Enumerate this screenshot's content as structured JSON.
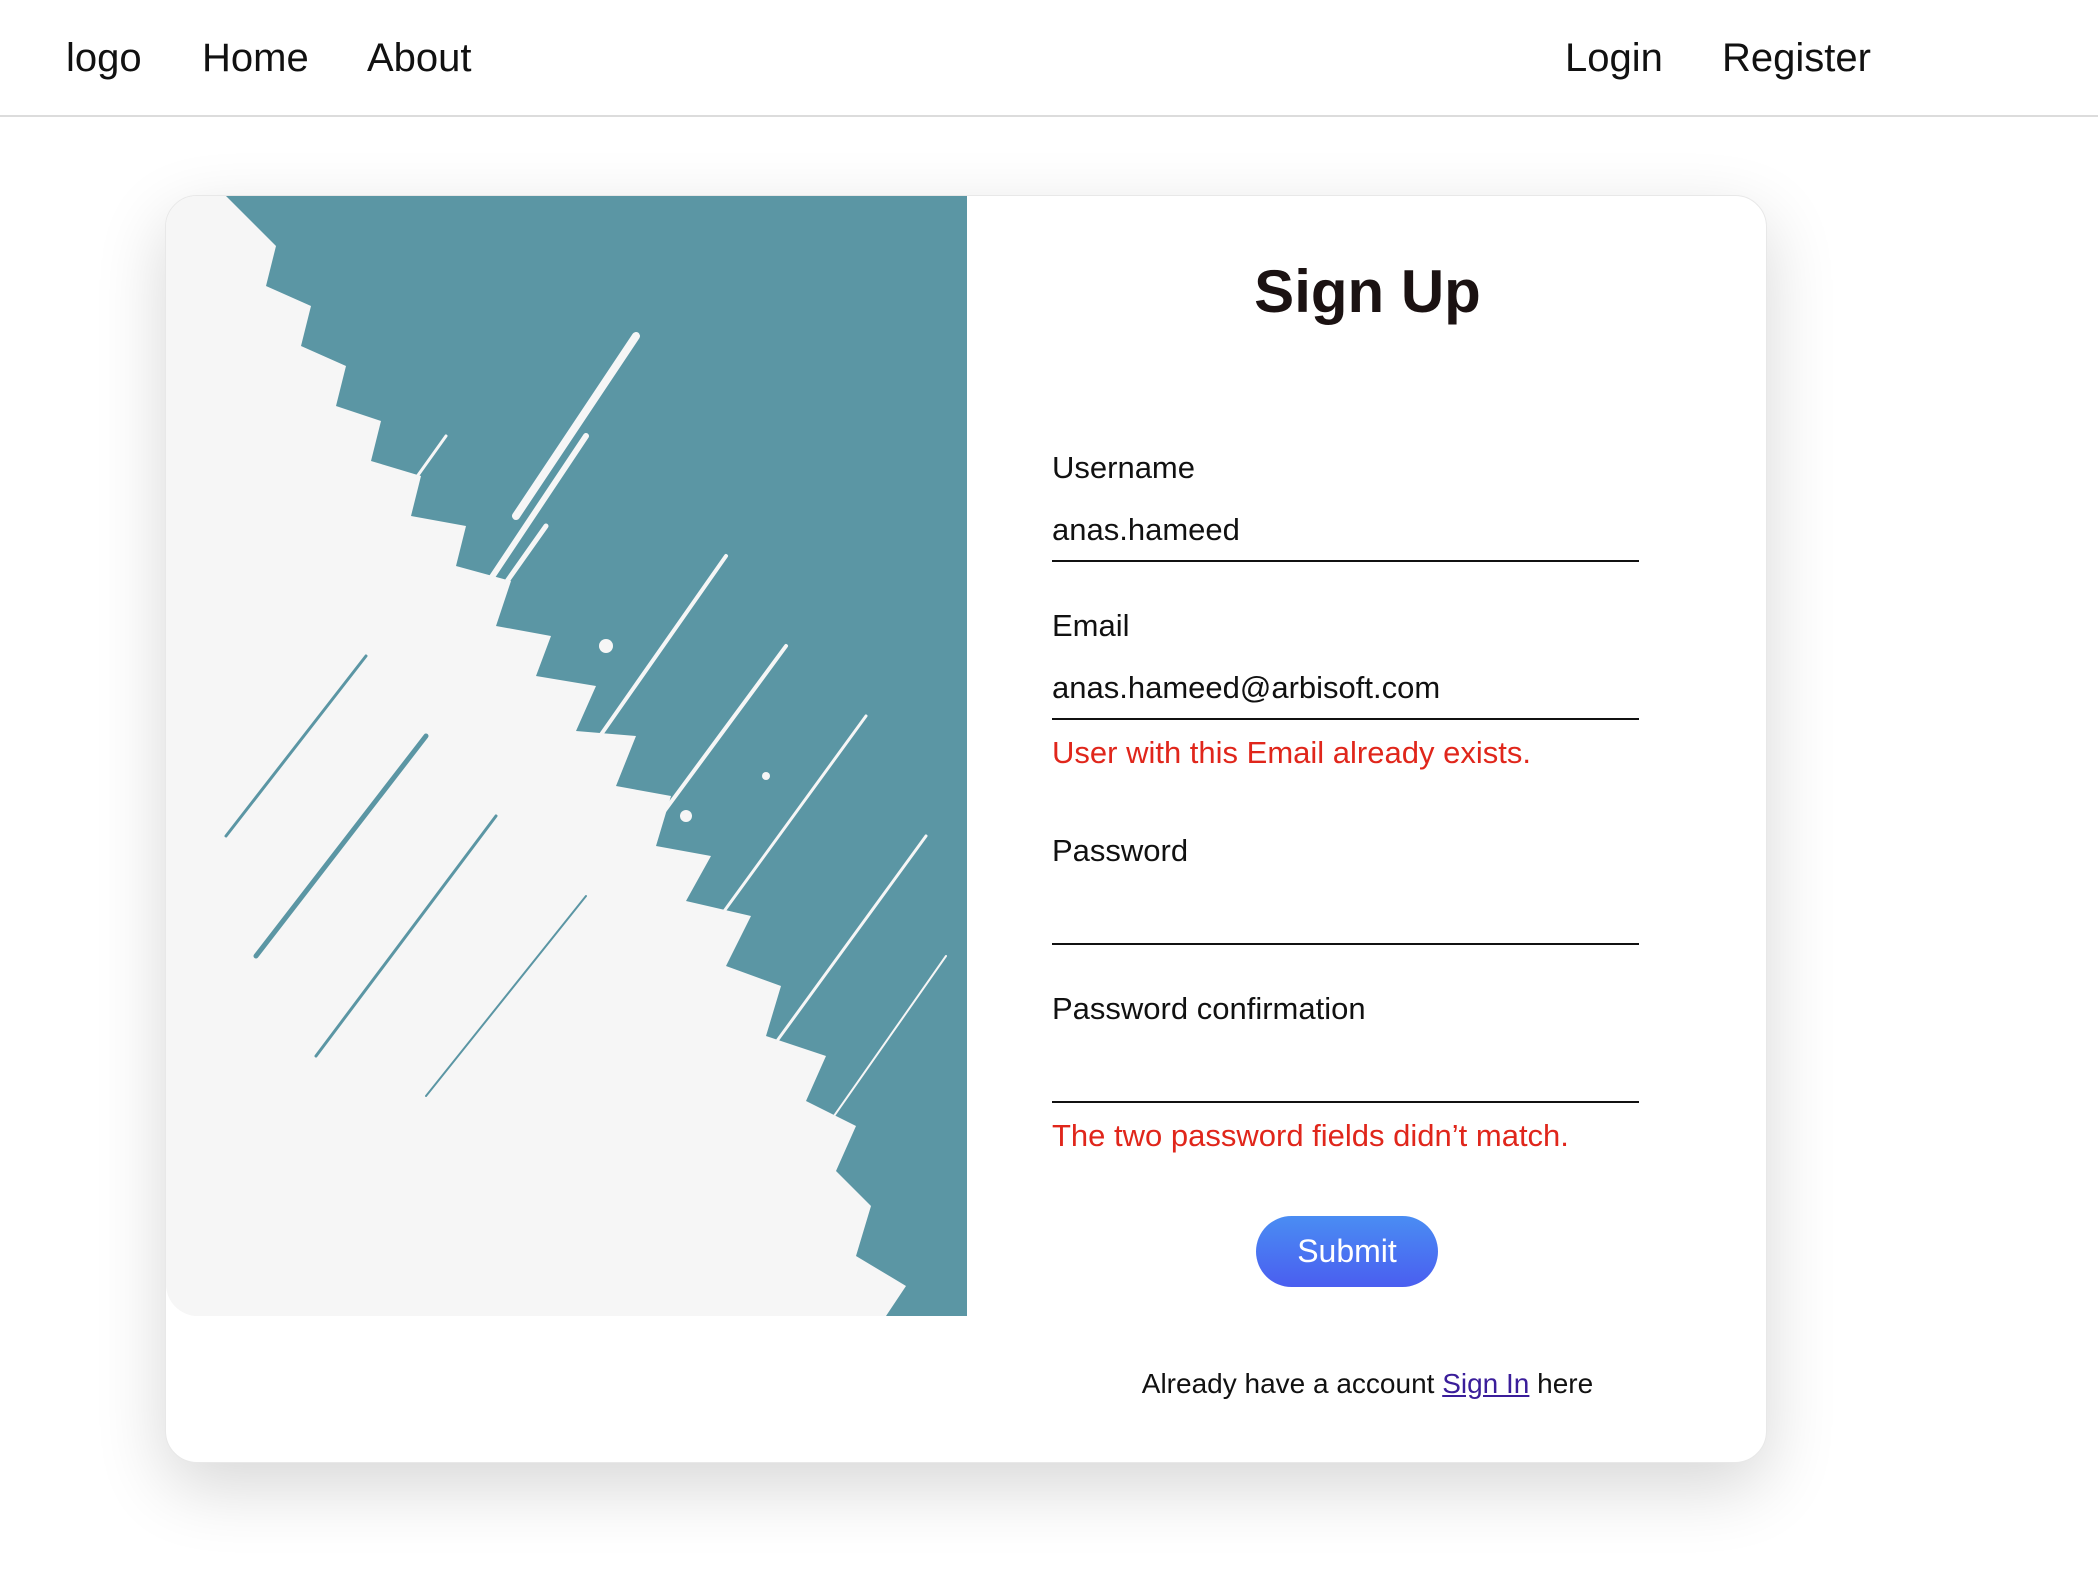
{
  "nav": {
    "logo": "logo",
    "home": "Home",
    "about": "About",
    "login": "Login",
    "register": "Register"
  },
  "form": {
    "title": "Sign Up",
    "username_label": "Username",
    "username_value": "anas.hameed",
    "email_label": "Email",
    "email_value": "anas.hameed@arbisoft.com",
    "email_error": "User with this Email already exists.",
    "password_label": "Password",
    "password_value": "",
    "password_confirm_label": "Password confirmation",
    "password_confirm_value": "",
    "password_error": "The two password fields didn’t match.",
    "submit_label": "Submit"
  },
  "footer": {
    "prefix": "Already have a account",
    "link": "Sign In",
    "suffix": "here"
  },
  "colors": {
    "teal": "#5b96a4",
    "error": "#e0261b",
    "button_top": "#4a8df3",
    "button_bottom": "#4a5ef0",
    "link": "#3a1d9a"
  }
}
